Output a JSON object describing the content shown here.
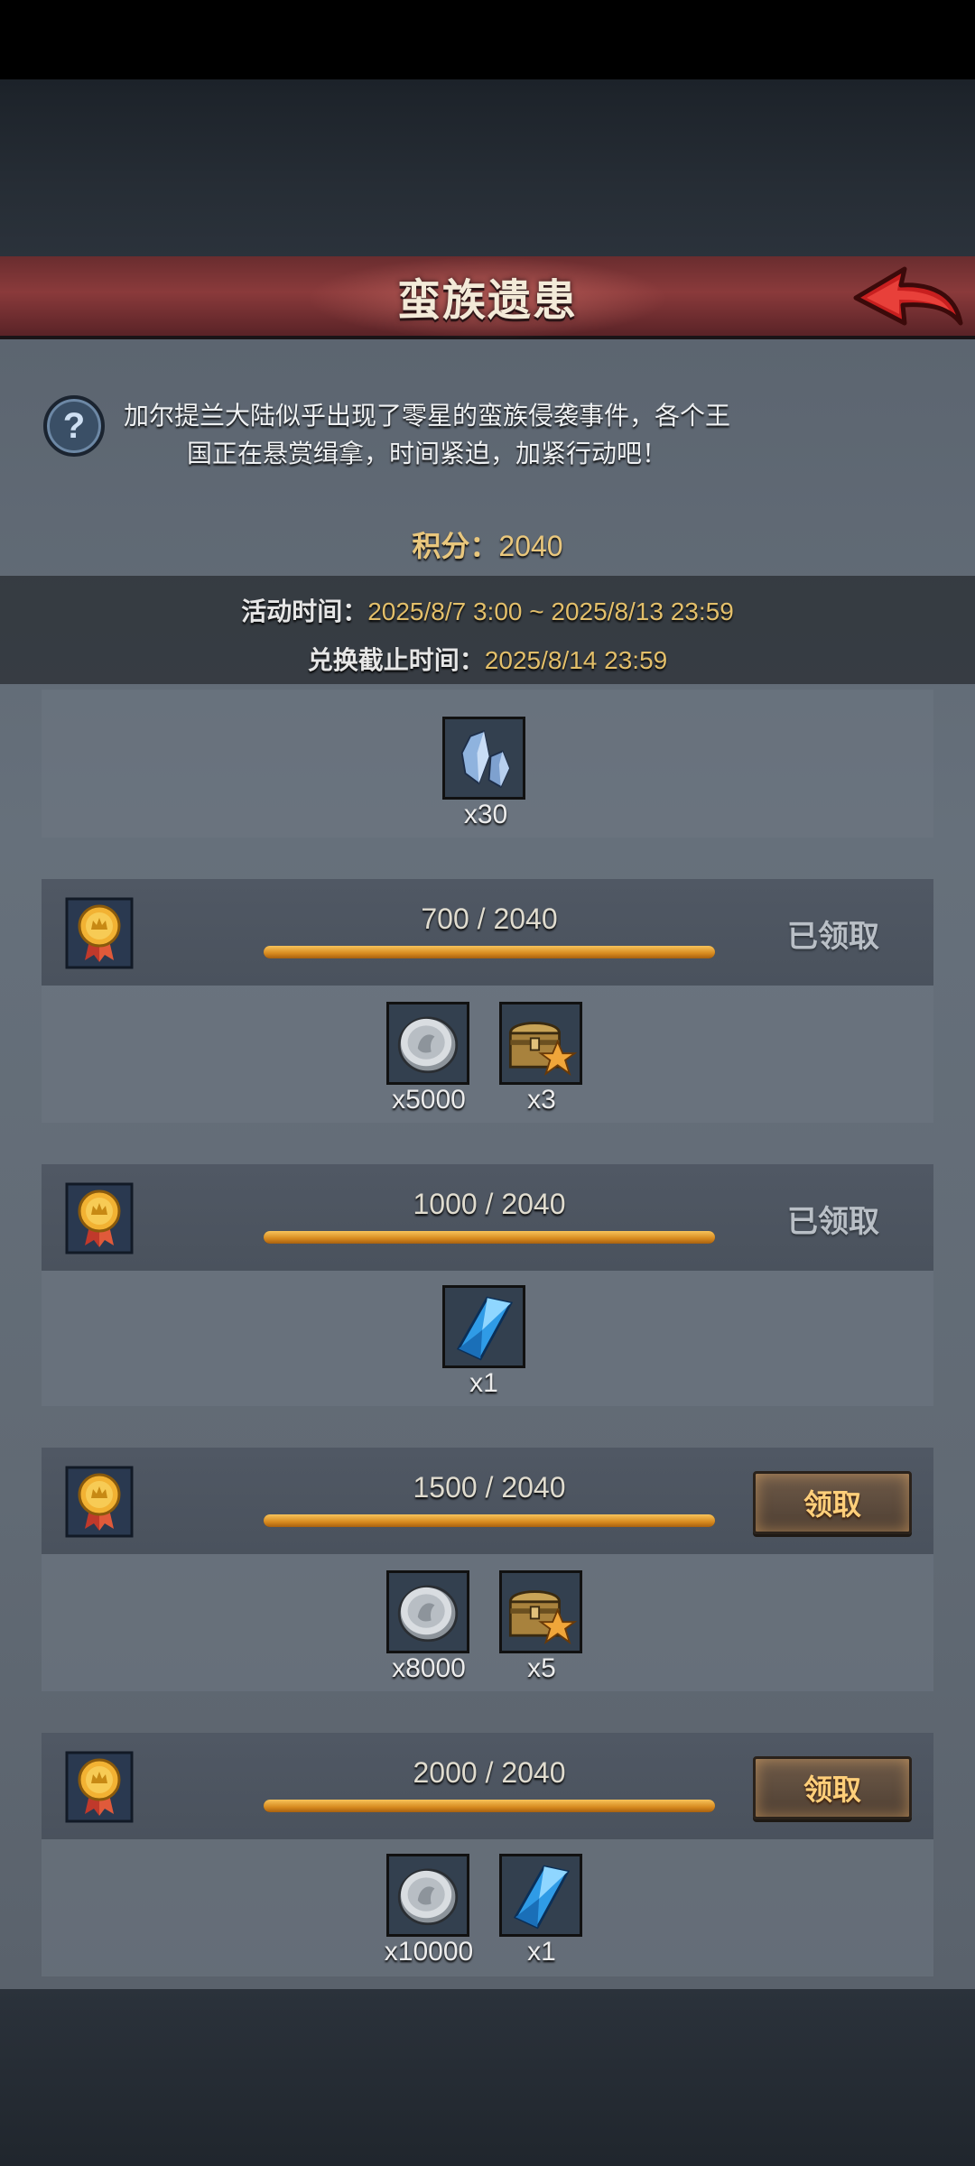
{
  "header": {
    "title": "蛮族遗患",
    "back_icon": "back-arrow-icon"
  },
  "intro": {
    "text": "加尔提兰大陆似乎出现了零星的蛮族侵袭事件，各个王国正在悬赏缉拿，时间紧迫，加紧行动吧！",
    "help_icon": "question-icon"
  },
  "score": {
    "label": "积分：",
    "value": "2040"
  },
  "times": {
    "activity_label": "活动时间：",
    "activity_value": "2025/8/7 3:00 ~ 2025/8/13 23:59",
    "exchange_label": "兑换截止时间：",
    "exchange_value": "2025/8/14 23:59"
  },
  "colors": {
    "gold": "#e3bf6a",
    "title_bar": "#8a3a3b",
    "progress": "#e9a22f"
  },
  "top_reward": {
    "icon": "crystal-cluster-icon",
    "qty": "x30"
  },
  "tiers": [
    {
      "progress_text": "700 / 2040",
      "progress": 1.0,
      "status": "已领取",
      "rewards": [
        {
          "icon": "silver-coin-icon",
          "qty": "x5000"
        },
        {
          "icon": "treasure-chest-icon",
          "qty": "x3"
        }
      ]
    },
    {
      "progress_text": "1000 / 2040",
      "progress": 1.0,
      "status": "已领取",
      "rewards": [
        {
          "icon": "blue-crystal-icon",
          "qty": "x1"
        }
      ]
    },
    {
      "progress_text": "1500 / 2040",
      "progress": 1.0,
      "button": "领取",
      "rewards": [
        {
          "icon": "silver-coin-icon",
          "qty": "x8000"
        },
        {
          "icon": "treasure-chest-icon",
          "qty": "x5"
        }
      ]
    },
    {
      "progress_text": "2000 / 2040",
      "progress": 1.0,
      "button": "领取",
      "rewards": [
        {
          "icon": "silver-coin-icon",
          "qty": "x10000"
        },
        {
          "icon": "blue-crystal-icon",
          "qty": "x1"
        }
      ]
    }
  ]
}
